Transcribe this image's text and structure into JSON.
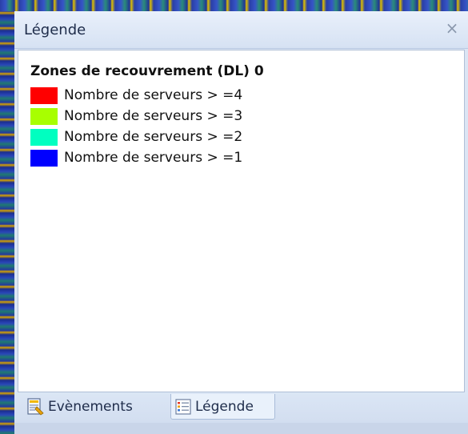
{
  "panel": {
    "title": "Légende",
    "close_glyph": "×",
    "legend_title": "Zones de recouvrement (DL) 0",
    "items": [
      {
        "label": "Nombre de serveurs > =4",
        "color": "#ff0000"
      },
      {
        "label": "Nombre de serveurs > =3",
        "color": "#a8ff00"
      },
      {
        "label": "Nombre de serveurs > =2",
        "color": "#00ffc0"
      },
      {
        "label": "Nombre de serveurs > =1",
        "color": "#0000ff"
      }
    ]
  },
  "tabs": [
    {
      "label": "Evènements",
      "icon": "events-icon",
      "active": false
    },
    {
      "label": "Légende",
      "icon": "legend-icon",
      "active": true
    }
  ]
}
